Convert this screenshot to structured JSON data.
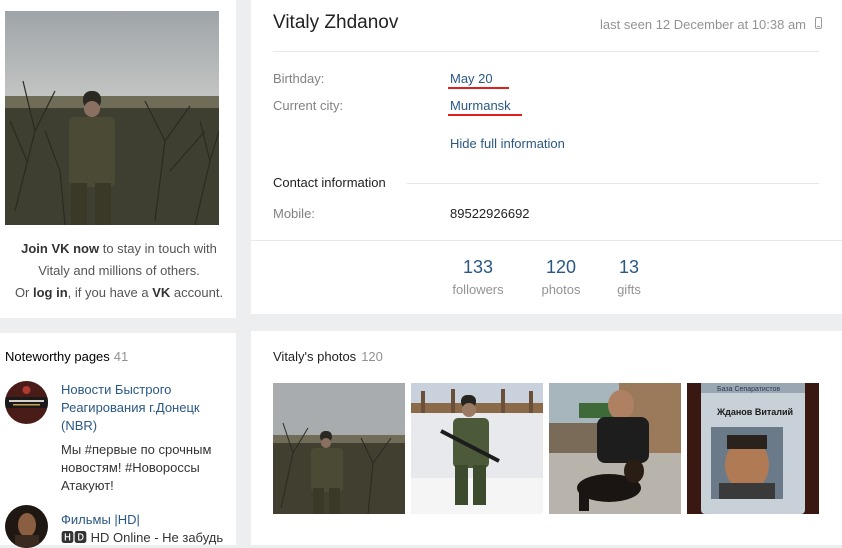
{
  "join": {
    "join_link": "Join VK now",
    "line1_rest": " to stay in touch with",
    "line2": "Vitaly and millions of others.",
    "or": "Or ",
    "login_link": "log in",
    "middle": ", if you have a ",
    "vk": "VK",
    "end": " account."
  },
  "noteworthy": {
    "title": "Noteworthy pages",
    "count": "41",
    "items": [
      {
        "title": "Новости Быстрого Реагирования г.Донецк (NBR)",
        "desc": "Мы #первые по срочным новостям! #Новороссы Атакуют!"
      },
      {
        "title": "Фильмы |HD|",
        "desc": "🅷🅳 HD Online - Не забудь"
      }
    ]
  },
  "profile": {
    "name": "Vitaly Zhdanov",
    "last_seen": "last seen 12 December at 10:38 am",
    "birthday_label": "Birthday:",
    "birthday_value": "May 20",
    "city_label": "Current city:",
    "city_value": "Murmansk",
    "hide_info": "Hide full information",
    "contact_heading": "Contact information",
    "mobile_label": "Mobile:",
    "mobile_value": "89522926692"
  },
  "stats": [
    {
      "num": "133",
      "label": "followers"
    },
    {
      "num": "120",
      "label": "photos"
    },
    {
      "num": "13",
      "label": "gifts"
    }
  ],
  "photos": {
    "title": "Vitaly's photos",
    "count": "120",
    "screenshot_header": "База Сепаратистов",
    "screenshot_name": "Жданов Виталий"
  },
  "colors": {
    "link": "#2a5885",
    "underline": "#e02020",
    "background": "#edeef0"
  }
}
